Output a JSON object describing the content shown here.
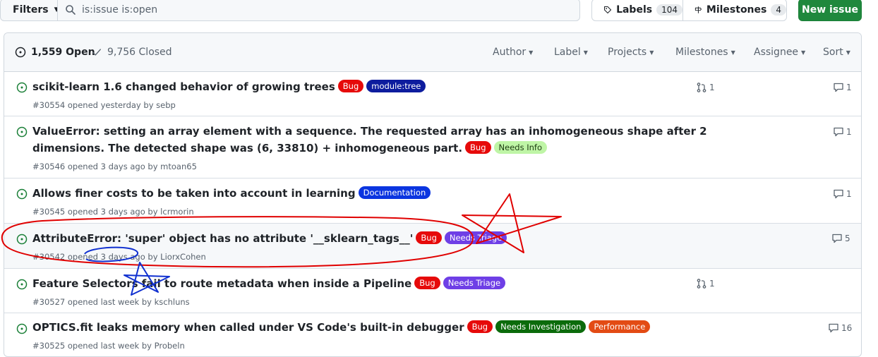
{
  "toolbar": {
    "filters_label": "Filters",
    "search_value": "is:issue is:open",
    "labels_label": "Labels",
    "labels_count": "104",
    "milestones_label": "Milestones",
    "milestones_count": "4",
    "new_issue_label": "New issue"
  },
  "list_header": {
    "open_label": "1,559 Open",
    "closed_label": "9,756 Closed",
    "filters": [
      "Author",
      "Label",
      "Projects",
      "Milestones",
      "Assignee",
      "Sort"
    ]
  },
  "issues": [
    {
      "title": "scikit-learn 1.6 changed behavior of growing trees",
      "labels": [
        "Bug",
        "module:tree"
      ],
      "meta": "#30554 opened yesterday by sebp",
      "linked_prs": "1",
      "comments": "1"
    },
    {
      "title_line1": "ValueError: setting an array element with a sequence. The requested array has an inhomogeneous shape after 2",
      "title_line2": "dimensions. The detected shape was (6, 33810) + inhomogeneous part.",
      "labels": [
        "Bug",
        "Needs Info"
      ],
      "meta": "#30546 opened 3 days ago by mtoan65",
      "comments": "1"
    },
    {
      "title": "Allows finer costs to be taken into account in learning",
      "labels": [
        "Documentation"
      ],
      "meta": "#30545 opened 3 days ago by lcrmorin",
      "comments": "1"
    },
    {
      "title": "AttributeError: 'super' object has no attribute '__sklearn_tags__'",
      "labels": [
        "Bug",
        "Needs Triage"
      ],
      "meta": "#30542 opened 3 days ago by LiorxCohen",
      "comments": "5"
    },
    {
      "title": "Feature Selectors fail to route metadata when inside a Pipeline",
      "labels": [
        "Bug",
        "Needs Triage"
      ],
      "meta": "#30527 opened last week by kschluns",
      "linked_prs": "1"
    },
    {
      "title": "OPTICS.fit leaks memory when called under VS Code's built-in debugger",
      "labels": [
        "Bug",
        "Needs Investigation",
        "Performance"
      ],
      "meta": "#30525 opened last week by Probeln",
      "comments": "16"
    }
  ],
  "colors": {
    "primary_button": "#1f883d",
    "label_bug": "#e60a0a",
    "label_module_tree": "#0d1c9e",
    "label_needs_info": "#bff5a6",
    "label_documentation": "#0b35e0",
    "label_needs_triage": "#6e3fe6",
    "label_needs_investigation": "#0b6b0b",
    "label_performance": "#e34b14",
    "open_issue_icon": "#1a7f37",
    "annotation_red": "#e00000",
    "annotation_blue": "#1030d0"
  },
  "icons": [
    "search-icon",
    "tag-icon",
    "milestone-icon",
    "issue-opened-icon",
    "check-icon",
    "git-pull-request-icon",
    "comment-icon"
  ]
}
